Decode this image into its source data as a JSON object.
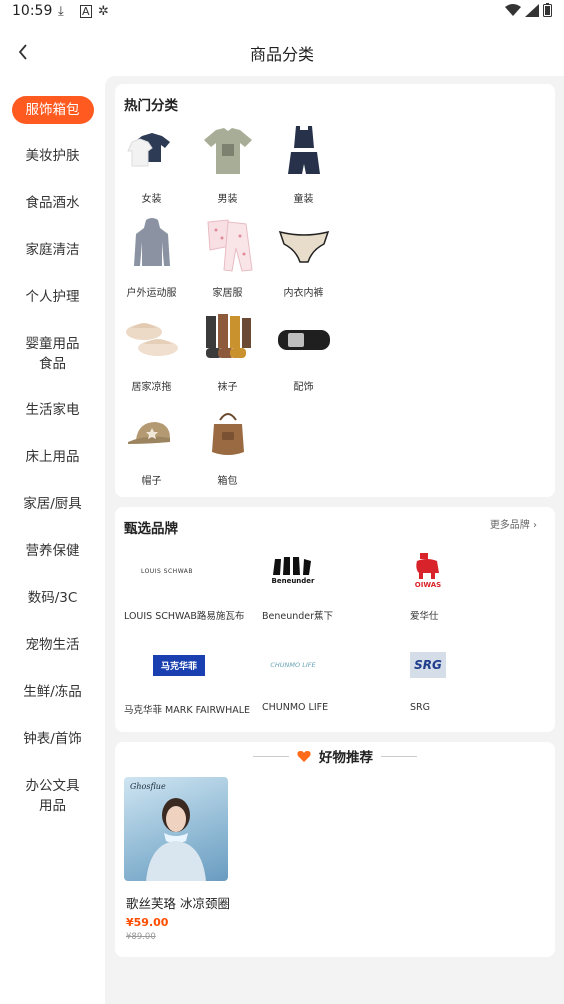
{
  "status_bar": {
    "time": "10:59",
    "left_icons": [
      "download-icon",
      "a-icon",
      "bug-icon"
    ],
    "right_icons": [
      "wifi-icon",
      "signal-icon",
      "battery-icon"
    ]
  },
  "header": {
    "title": "商品分类"
  },
  "sidebar": {
    "items": [
      {
        "label": "服饰箱包",
        "active": true
      },
      {
        "label": "美妆护肤"
      },
      {
        "label": "食品酒水"
      },
      {
        "label": "家庭清洁"
      },
      {
        "label": "个人护理"
      },
      {
        "label": "婴童用品\n食品"
      },
      {
        "label": "生活家电"
      },
      {
        "label": "床上用品"
      },
      {
        "label": "家居/厨具"
      },
      {
        "label": "营养保健"
      },
      {
        "label": "数码/3C"
      },
      {
        "label": "宠物生活"
      },
      {
        "label": "生鲜/冻品"
      },
      {
        "label": "钟表/首饰"
      },
      {
        "label": "办公文具\n用品"
      }
    ]
  },
  "hot_categories": {
    "title": "热门分类",
    "items": [
      {
        "label": "女装",
        "icon": "women-clothing-icon"
      },
      {
        "label": "男装",
        "icon": "men-clothing-icon"
      },
      {
        "label": "童装",
        "icon": "kids-clothing-icon"
      },
      {
        "label": "户外运动服",
        "icon": "sportswear-icon"
      },
      {
        "label": "家居服",
        "icon": "homewear-icon"
      },
      {
        "label": "内衣内裤",
        "icon": "underwear-icon"
      },
      {
        "label": "居家凉拖",
        "icon": "slippers-icon"
      },
      {
        "label": "袜子",
        "icon": "socks-icon"
      },
      {
        "label": "配饰",
        "icon": "belt-icon"
      },
      {
        "label": "帽子",
        "icon": "cap-icon"
      },
      {
        "label": "箱包",
        "icon": "bag-icon"
      }
    ]
  },
  "brands": {
    "title": "甄选品牌",
    "more_label": "更多品牌",
    "items": [
      {
        "label": "LOUIS SCHWAB路易施瓦布",
        "logo_text": "LOUIS SCHWAB"
      },
      {
        "label": "Beneunder蕉下",
        "logo_text": "Beneunder"
      },
      {
        "label": "爱华仕",
        "logo_text": "OIWAS"
      },
      {
        "label": "马克华菲 MARK FAIRWHALE",
        "logo_text": "马克华菲"
      },
      {
        "label": "CHUNMO LIFE",
        "logo_text": "CHUNMO LIFE"
      },
      {
        "label": "SRG",
        "logo_text": "SRG"
      }
    ]
  },
  "recommend": {
    "title": "好物推荐",
    "products": [
      {
        "name": "歌丝芙珞 冰凉颈圈",
        "price": "¥59.00",
        "old_price": "¥89.00",
        "image_brand": "Ghosflue"
      }
    ]
  },
  "colors": {
    "accent": "#ff5a1f",
    "price": "#ff4d00",
    "background": "#f3f3f3"
  }
}
